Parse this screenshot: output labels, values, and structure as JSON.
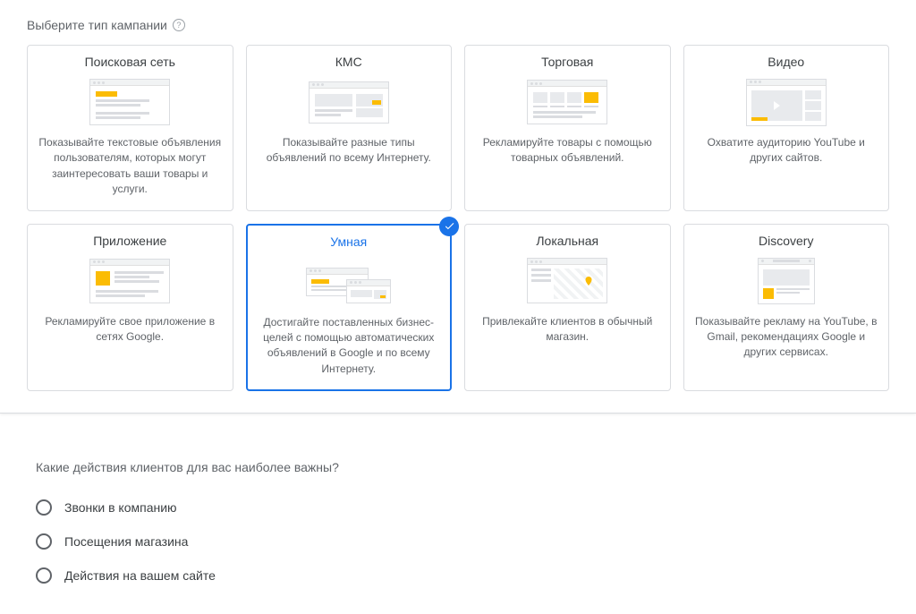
{
  "section1": {
    "heading": "Выберите тип кампании",
    "cards": [
      {
        "title": "Поисковая сеть",
        "desc": "Показывайте текстовые объявления пользователям, которых могут заинтересовать ваши товары и услуги.",
        "selected": false
      },
      {
        "title": "КМС",
        "desc": "Показывайте разные типы объявлений по всему Интернету.",
        "selected": false
      },
      {
        "title": "Торговая",
        "desc": "Рекламируйте товары с помощью товарных объявлений.",
        "selected": false
      },
      {
        "title": "Видео",
        "desc": "Охватите аудиторию YouTube и других сайтов.",
        "selected": false
      },
      {
        "title": "Приложение",
        "desc": "Рекламируйте свое приложение в сетях Google.",
        "selected": false
      },
      {
        "title": "Умная",
        "desc": "Достигайте поставленных бизнес-целей с помощью автоматических объявлений в Google и по всему Интернету.",
        "selected": true
      },
      {
        "title": "Локальная",
        "desc": "Привлекайте клиентов в обычный магазин.",
        "selected": false
      },
      {
        "title": "Discovery",
        "desc": "Показывайте рекламу на YouTube, в Gmail, рекомендациях Google и других сервисах.",
        "selected": false
      }
    ]
  },
  "section2": {
    "heading": "Какие действия клиентов для вас наиболее важны?",
    "options": [
      {
        "label": "Звонки в компанию"
      },
      {
        "label": "Посещения магазина"
      },
      {
        "label": "Действия на вашем сайте"
      }
    ]
  }
}
